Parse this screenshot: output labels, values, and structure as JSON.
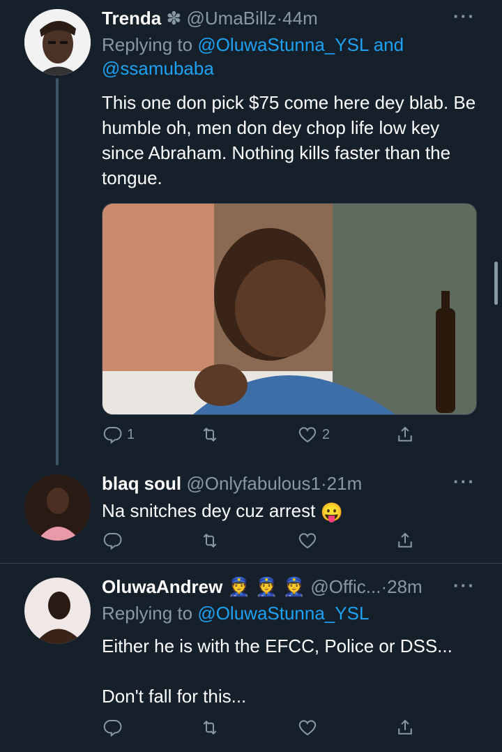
{
  "tweets": [
    {
      "name": "Trenda",
      "name_badge": "✽",
      "handle": "@UmaBillz",
      "time": "44m",
      "replying_prefix": "Replying to",
      "replying_links": [
        "@OluwaStunna_YSL",
        "and",
        "@ssamubaba"
      ],
      "text": "This one don pick $75 come here dey blab. Be humble oh, men don dey chop life low key since Abraham. Nothing kills faster than the tongue.",
      "reply_count": "1",
      "retweet_count": "",
      "like_count": "2"
    },
    {
      "name": "blaq soul",
      "handle": "@Onlyfabulous1",
      "time": "21m",
      "text": "Na snitches dey cuz arrest",
      "emoji": "😛"
    },
    {
      "name": "OluwaAndrew",
      "name_emojis": "👮 👮 👮",
      "handle": "@Offic...",
      "time": "28m",
      "replying_prefix": "Replying to",
      "replying_links": [
        "@OluwaStunna_YSL"
      ],
      "text_lines": [
        "Either he is with the EFCC, Police or DSS...",
        "",
        "Don't fall for this..."
      ]
    }
  ],
  "more_icon": "more-horizontal-icon",
  "colors": {
    "background": "#15202b",
    "secondary_text": "#8899a6",
    "link": "#1da1f2",
    "divider": "#38444d"
  }
}
